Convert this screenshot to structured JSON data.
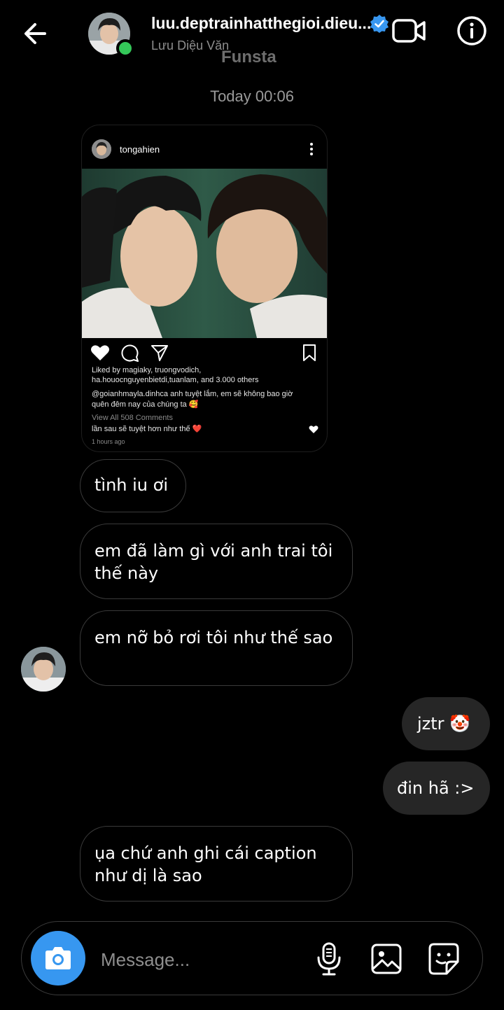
{
  "header": {
    "username": "luu.deptrainhatthegioi.dieu...",
    "fullname": "Lưu Diệu Văn",
    "overlay_label": "Funsta"
  },
  "thread": {
    "timestamp": "Today 00:06"
  },
  "shared_post": {
    "author": "tongahien",
    "liked_by_prefix": "Liked by ",
    "liked_by_names": "magiaky, truongvodich,",
    "liked_by_line2": "ha.houocnguyenbietdi,tuanlam, and 3.000 others",
    "caption_line1": "@goianhmayla.dinhca anh tuyệt lắm, em sẽ không bao giờ",
    "caption_line2": "quên đêm nay của chúng ta 🥰",
    "view_comments": "View All 508 Comments",
    "comment": "lần sau sẽ tuyệt hơn như thế ❤️",
    "time_ago": "1 hours ago"
  },
  "messages": [
    {
      "from": "them",
      "text": "tình iu ơi"
    },
    {
      "from": "them",
      "text": "em đã làm gì với anh trai tôi thế này"
    },
    {
      "from": "them",
      "text": "em nỡ bỏ rơi tôi như thế sao"
    },
    {
      "from": "me",
      "text": "jztr 🤡"
    },
    {
      "from": "me",
      "text": "đin hã :>"
    },
    {
      "from": "them",
      "text": "ụa chứ anh ghi cái caption như dị là sao"
    }
  ],
  "composer": {
    "placeholder": "Message..."
  },
  "colors": {
    "background": "#000000",
    "accent": "#3797f0",
    "verified": "#3897f0",
    "online": "#34c759",
    "own_bubble": "#262626"
  },
  "icons": [
    "back-arrow-icon",
    "verified-badge-icon",
    "video-call-icon",
    "info-icon",
    "camera-icon",
    "microphone-icon",
    "gallery-icon",
    "sticker-icon",
    "heart-icon",
    "comment-icon",
    "share-icon",
    "bookmark-icon",
    "more-icon"
  ]
}
